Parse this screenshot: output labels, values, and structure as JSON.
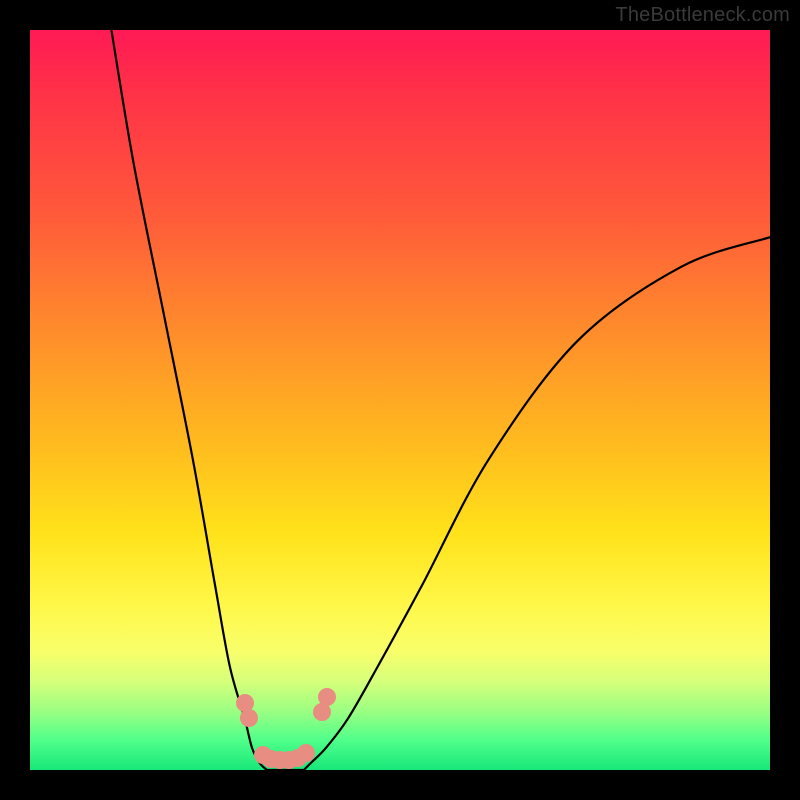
{
  "watermark": "TheBottleneck.com",
  "chart_data": {
    "type": "line",
    "title": "",
    "xlabel": "",
    "ylabel": "",
    "xlim": [
      0,
      100
    ],
    "ylim": [
      0,
      100
    ],
    "grid": false,
    "series": [
      {
        "name": "left-curve",
        "x": [
          11,
          14,
          18,
          22,
          25,
          27,
          29,
          30,
          31,
          32
        ],
        "y": [
          100,
          82,
          62,
          42,
          25,
          14,
          7,
          3,
          1,
          0
        ]
      },
      {
        "name": "right-curve",
        "x": [
          37,
          38,
          40,
          43,
          47,
          53,
          62,
          74,
          88,
          100
        ],
        "y": [
          0,
          1,
          3,
          7,
          14,
          25,
          42,
          58,
          68,
          72
        ]
      },
      {
        "name": "dip-floor",
        "x": [
          32,
          33,
          34,
          35,
          36,
          37
        ],
        "y": [
          0,
          0,
          0,
          0,
          0,
          0
        ]
      }
    ],
    "markers": {
      "color": "#e88d82",
      "points": [
        {
          "x": 29.0,
          "y": 9.0
        },
        {
          "x": 29.6,
          "y": 7.0
        },
        {
          "x": 31.5,
          "y": 2.0
        },
        {
          "x": 32.6,
          "y": 1.5
        },
        {
          "x": 33.8,
          "y": 1.3
        },
        {
          "x": 35.0,
          "y": 1.3
        },
        {
          "x": 36.2,
          "y": 1.6
        },
        {
          "x": 37.3,
          "y": 2.3
        },
        {
          "x": 39.5,
          "y": 7.8
        },
        {
          "x": 40.2,
          "y": 9.8
        }
      ]
    },
    "background_gradient": {
      "top": "#ff1a55",
      "mid": "#ffe21a",
      "bottom": "#18e77a"
    }
  }
}
